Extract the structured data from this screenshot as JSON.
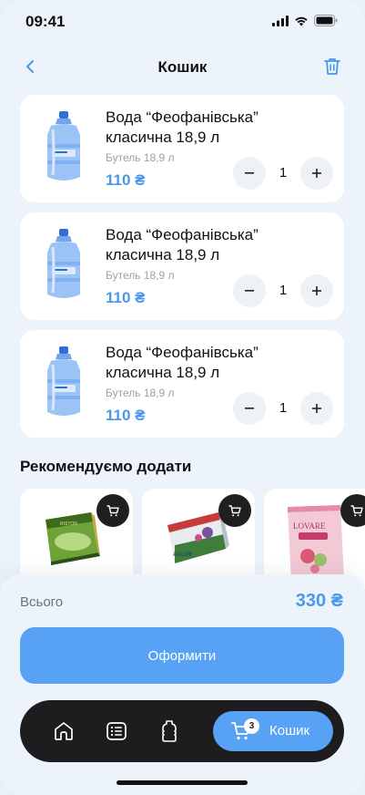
{
  "status_bar": {
    "time": "09:41"
  },
  "header": {
    "title": "Кошик"
  },
  "cart_items": [
    {
      "name": "Вода “Феофанівська” класична 18,9 л",
      "subtitle": "Бутель 18,9 л",
      "price": "110 ₴",
      "quantity": "1"
    },
    {
      "name": "Вода “Феофанівська” класична 18,9 л",
      "subtitle": "Бутель 18,9 л",
      "price": "110 ₴",
      "quantity": "1"
    },
    {
      "name": "Вода “Феофанівська” класична 18,9 л",
      "subtitle": "Бутель 18,9 л",
      "price": "110 ₴",
      "quantity": "1"
    }
  ],
  "recommendations": {
    "title": "Рекомендуємо додати",
    "items": [
      {
        "image": "green-tea-box",
        "brand_text": "RISTON"
      },
      {
        "image": "herbal-tea-box",
        "brand_text": "Ascofit"
      },
      {
        "image": "lovare-tea-box",
        "brand_text": "LOVARE"
      }
    ]
  },
  "summary": {
    "total_label": "Всього",
    "total_value": "330 ₴",
    "checkout_label": "Оформити"
  },
  "tab_bar": {
    "cart_label": "Кошик",
    "cart_badge": "3",
    "tabs": [
      "home-icon",
      "list-icon",
      "bottle-icon",
      "cart-icon"
    ]
  },
  "colors": {
    "accent": "#57a2f5",
    "price": "#4a98ec",
    "dark": "#1d1d1f",
    "background": "#edf3fa"
  }
}
